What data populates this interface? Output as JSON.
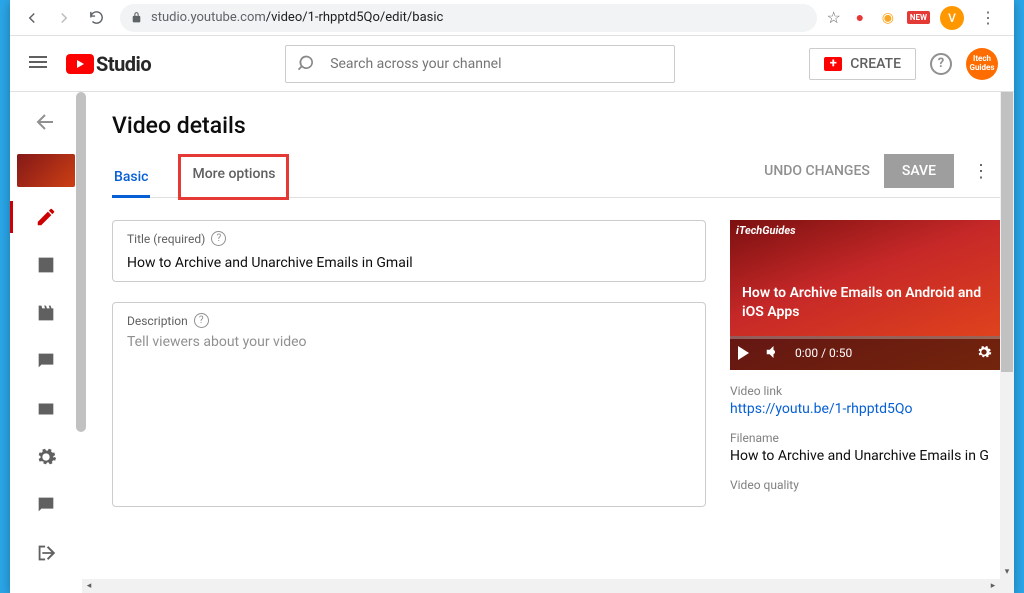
{
  "browser": {
    "url_domain": "studio.youtube.com",
    "url_path": "/video/1-rhpptd5Qo/edit/basic",
    "new_badge": "NEW",
    "avatar_letter": "V"
  },
  "header": {
    "logo_text": "Studio",
    "search_placeholder": "Search across your channel",
    "create_label": "CREATE",
    "channel_badge": "Itech Guides"
  },
  "page": {
    "title": "Video details",
    "tabs": {
      "basic": "Basic",
      "more": "More options"
    },
    "actions": {
      "undo": "UNDO CHANGES",
      "save": "SAVE"
    }
  },
  "fields": {
    "title_label": "Title (required)",
    "title_value": "How to Archive and Unarchive Emails in Gmail",
    "desc_label": "Description",
    "desc_placeholder": "Tell viewers about your video",
    "desc_value": ""
  },
  "preview": {
    "brand": "iTechGuides",
    "slide_title": "How to Archive Emails on Android and iOS Apps",
    "time": "0:00 / 0:50"
  },
  "meta": {
    "link_label": "Video link",
    "link_value": "https://youtu.be/1-rhpptd5Qo",
    "filename_label": "Filename",
    "filename_value": "How to Archive and Unarchive Emails in G",
    "quality_label": "Video quality"
  }
}
